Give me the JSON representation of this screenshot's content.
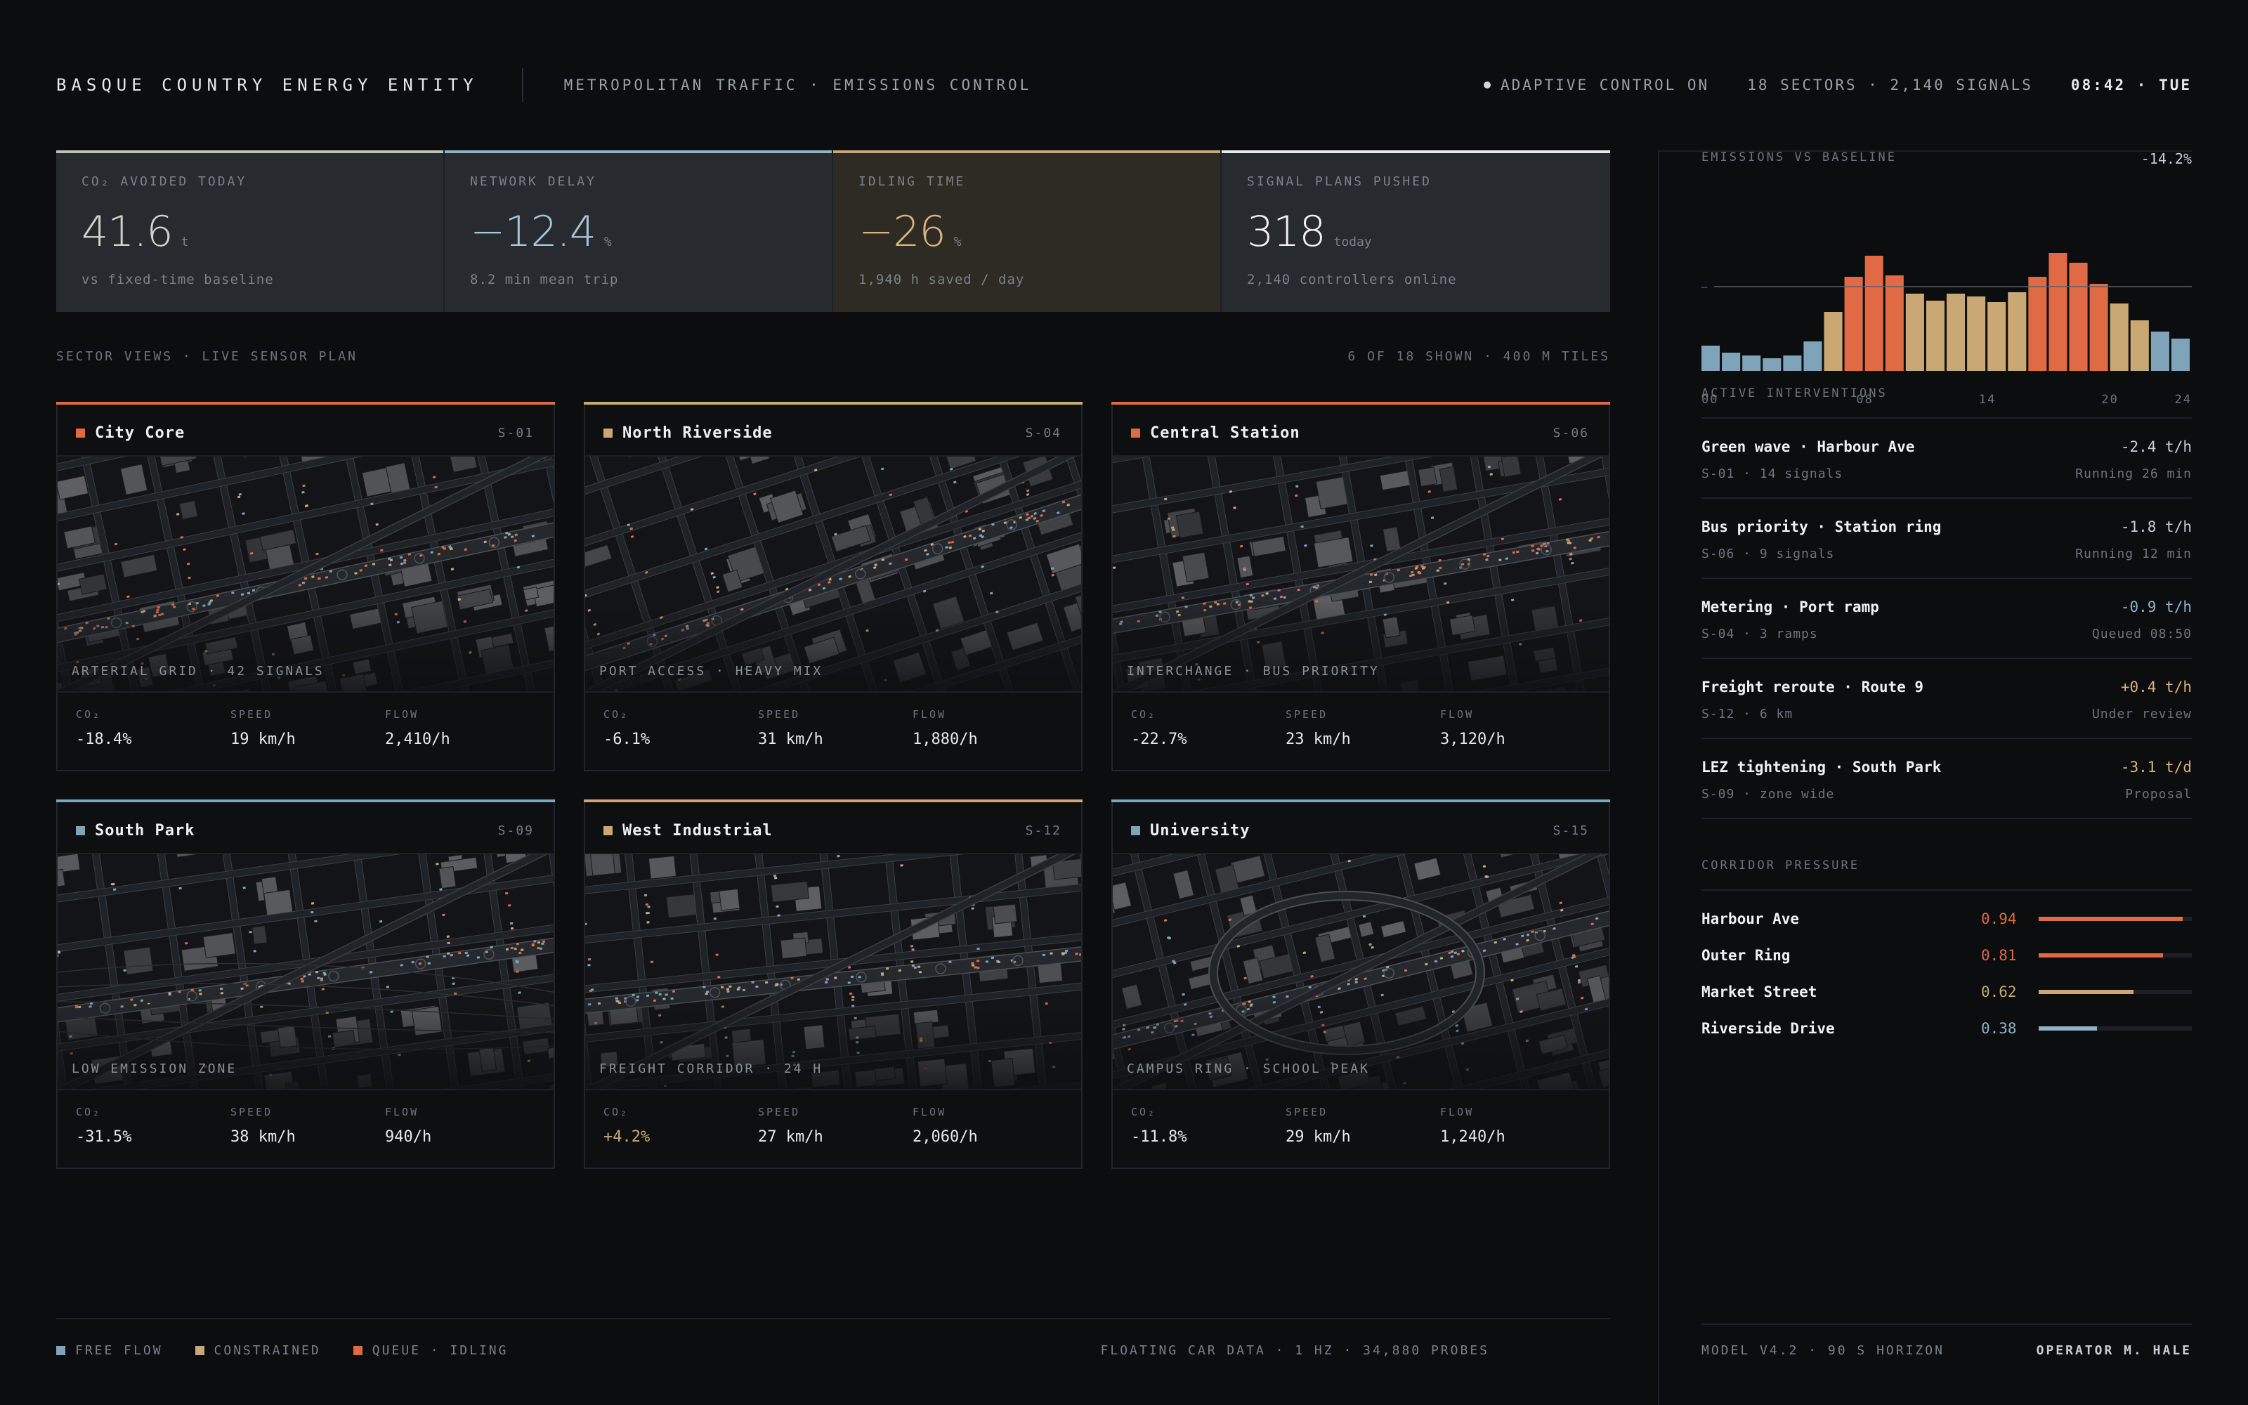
{
  "colors": {
    "free": "#7fa3b8",
    "constrained": "#c9a874",
    "queue": "#e06a44",
    "white": "#e6e8ea"
  },
  "header": {
    "brand": "BASQUE COUNTRY ENERGY ENTITY",
    "subtitle": "METROPOLITAN TRAFFIC · EMISSIONS CONTROL",
    "status": "ADAPTIVE CONTROL ON",
    "sectors": "18 SECTORS · 2,140 SIGNALS",
    "time": "08:42 · TUE"
  },
  "kpis": [
    {
      "label": "CO₂ AVOIDED TODAY",
      "value": "41.6",
      "unit": "t",
      "sub": "vs fixed-time baseline",
      "accent": "#b9c4b1",
      "valueColor": "#cdd6c8"
    },
    {
      "label": "NETWORK DELAY",
      "value": "−12.4",
      "unit": "%",
      "sub": "8.2 min mean trip",
      "accent": "#8fb3c8",
      "valueColor": "#a9c6d6"
    },
    {
      "label": "IDLING TIME",
      "value": "−26",
      "unit": "%",
      "sub": "1,940 h saved / day",
      "accent": "#c9a874",
      "valueColor": "#d8b47e"
    },
    {
      "label": "SIGNAL PLANS PUSHED",
      "value": "318",
      "unit": "today",
      "sub": "2,140 controllers online",
      "accent": "#e6e8ea",
      "valueColor": "#eef0f2"
    }
  ],
  "sector_header": {
    "left": "SECTOR VIEWS · LIVE SENSOR PLAN",
    "right": "6 OF 18 SHOWN · 400 M TILES"
  },
  "sectors": [
    {
      "name": "City Core",
      "code": "S-01",
      "status": "queue",
      "caption": "ARTERIAL GRID · 42 SIGNALS",
      "stats": [
        {
          "label": "CO₂",
          "value": "-18.4%"
        },
        {
          "label": "SPEED",
          "value": "19 km/h"
        },
        {
          "label": "FLOW",
          "value": "2,410/h"
        }
      ]
    },
    {
      "name": "North Riverside",
      "code": "S-04",
      "status": "constrained",
      "caption": "PORT ACCESS · HEAVY MIX",
      "stats": [
        {
          "label": "CO₂",
          "value": "-6.1%"
        },
        {
          "label": "SPEED",
          "value": "31 km/h"
        },
        {
          "label": "FLOW",
          "value": "1,880/h"
        }
      ]
    },
    {
      "name": "Central Station",
      "code": "S-06",
      "status": "queue",
      "caption": "INTERCHANGE · BUS PRIORITY",
      "stats": [
        {
          "label": "CO₂",
          "value": "-22.7%"
        },
        {
          "label": "SPEED",
          "value": "23 km/h"
        },
        {
          "label": "FLOW",
          "value": "3,120/h"
        }
      ]
    },
    {
      "name": "South Park",
      "code": "S-09",
      "status": "free",
      "caption": "LOW EMISSION ZONE",
      "stats": [
        {
          "label": "CO₂",
          "value": "-31.5%"
        },
        {
          "label": "SPEED",
          "value": "38 km/h"
        },
        {
          "label": "FLOW",
          "value": "940/h"
        }
      ]
    },
    {
      "name": "West Industrial",
      "code": "S-12",
      "status": "constrained",
      "caption": "FREIGHT CORRIDOR · 24 H",
      "stats": [
        {
          "label": "CO₂",
          "value": "+4.2%"
        },
        {
          "label": "SPEED",
          "value": "27 km/h"
        },
        {
          "label": "FLOW",
          "value": "2,060/h"
        }
      ]
    },
    {
      "name": "University",
      "code": "S-15",
      "status": "free",
      "caption": "CAMPUS RING · SCHOOL PEAK",
      "stats": [
        {
          "label": "CO₂",
          "value": "-11.8%"
        },
        {
          "label": "SPEED",
          "value": "29 km/h"
        },
        {
          "label": "FLOW",
          "value": "1,240/h"
        }
      ]
    }
  ],
  "emissions": {
    "label": "EMISSIONS VS BASELINE",
    "delta": "-14.2%"
  },
  "chart_data": {
    "type": "bar",
    "categories": [
      "00",
      "01",
      "02",
      "03",
      "04",
      "05",
      "06",
      "07",
      "08",
      "09",
      "10",
      "11",
      "12",
      "13",
      "14",
      "15",
      "16",
      "17",
      "18",
      "19",
      "20",
      "21",
      "22",
      "23"
    ],
    "values": [
      18,
      13,
      11,
      9,
      11,
      21,
      42,
      67,
      82,
      68,
      55,
      50,
      55,
      53,
      49,
      56,
      67,
      84,
      77,
      62,
      48,
      36,
      28,
      23
    ],
    "status": [
      "free",
      "free",
      "free",
      "free",
      "free",
      "free",
      "constrained",
      "queue",
      "queue",
      "queue",
      "constrained",
      "constrained",
      "constrained",
      "constrained",
      "constrained",
      "constrained",
      "queue",
      "queue",
      "queue",
      "queue",
      "constrained",
      "constrained",
      "free",
      "free"
    ],
    "baseline": 60,
    "ylim": [
      0,
      90
    ],
    "tick_labels": [
      "00",
      "08",
      "14",
      "20",
      "24"
    ],
    "baseline_label": "—"
  },
  "interventions": {
    "label": "ACTIVE INTERVENTIONS",
    "items": [
      {
        "name": "Green wave · Harbour Ave",
        "value": "-2.4 t/h",
        "color": "#c9cdd1",
        "sub": "S-01 · 14 signals",
        "state": "Running 26 min"
      },
      {
        "name": "Bus priority · Station ring",
        "value": "-1.8 t/h",
        "color": "#c9cdd1",
        "sub": "S-06 · 9 signals",
        "state": "Running 12 min"
      },
      {
        "name": "Metering · Port ramp",
        "value": "-0.9 t/h",
        "color": "#8fb3c8",
        "sub": "S-04 · 3 ramps",
        "state": "Queued 08:50"
      },
      {
        "name": "Freight reroute · Route 9",
        "value": "+0.4 t/h",
        "color": "#d8b47e",
        "sub": "S-12 · 6 km",
        "state": "Under review"
      },
      {
        "name": "LEZ tightening · South Park",
        "value": "-3.1 t/d",
        "color": "#d8b47e",
        "sub": "S-09 · zone wide",
        "state": "Proposal"
      }
    ]
  },
  "corridors": {
    "label": "CORRIDOR PRESSURE",
    "items": [
      {
        "name": "Harbour Ave",
        "value": "0.94",
        "level": 0.94,
        "color": "#e06a44"
      },
      {
        "name": "Outer Ring",
        "value": "0.81",
        "level": 0.81,
        "color": "#e06a44"
      },
      {
        "name": "Market Street",
        "value": "0.62",
        "level": 0.62,
        "color": "#c9a874"
      },
      {
        "name": "Riverside Drive",
        "value": "0.38",
        "level": 0.38,
        "color": "#8fb3c8"
      }
    ]
  },
  "footer": {
    "legend": [
      {
        "label": "FREE FLOW",
        "color": "#7fa3b8"
      },
      {
        "label": "CONSTRAINED",
        "color": "#c9a874"
      },
      {
        "label": "QUEUE · IDLING",
        "color": "#e06a44"
      }
    ],
    "source": "FLOATING CAR DATA · 1 HZ · 34,880 PROBES",
    "model": "MODEL V4.2 · 90 S HORIZON",
    "operator": "OPERATOR M. HALE"
  }
}
